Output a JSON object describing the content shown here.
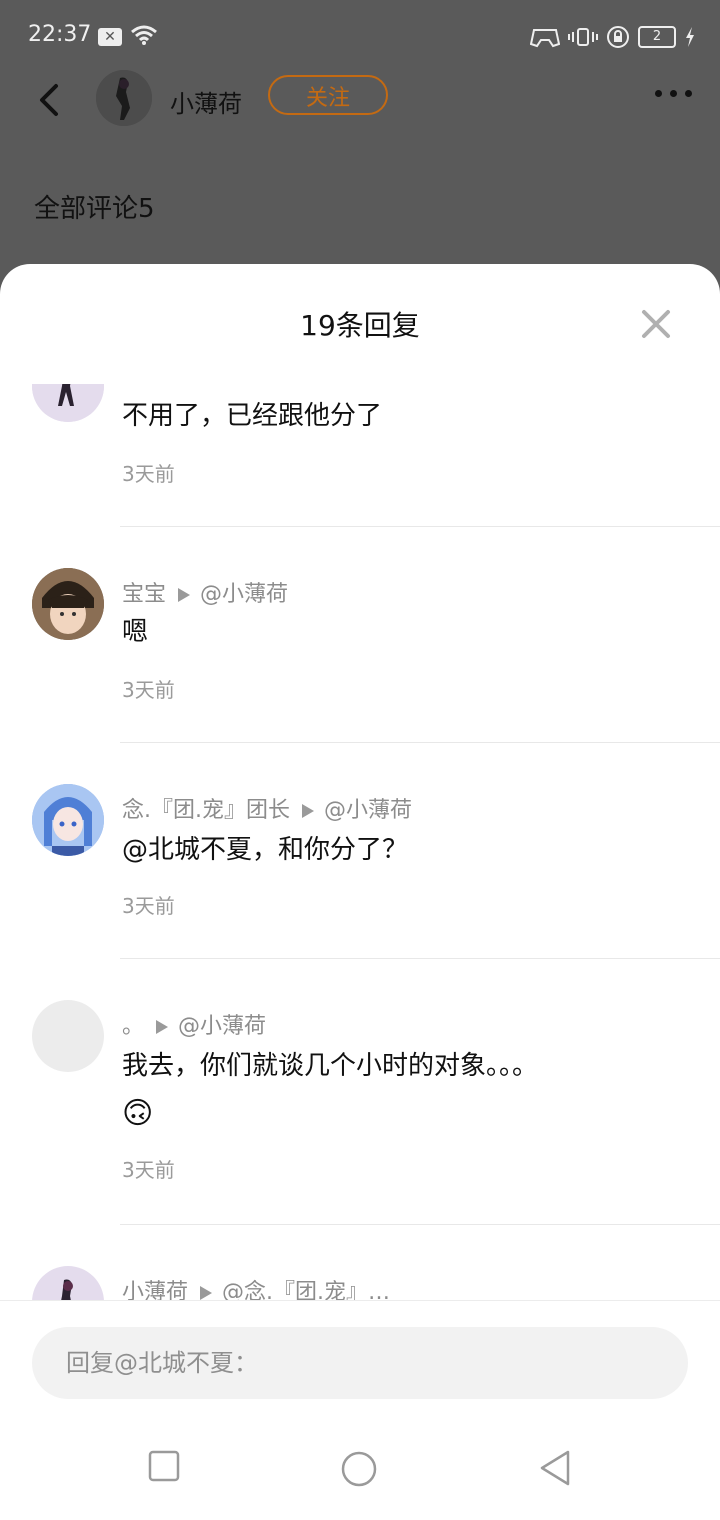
{
  "status": {
    "time": "22:37",
    "battery": "2"
  },
  "header": {
    "username": "小薄荷",
    "follow_label": "关注",
    "comments_heading": "全部评论5"
  },
  "sheet": {
    "title": "19条回复",
    "replies": [
      {
        "author": "",
        "target": "",
        "text": "不用了，已经跟他分了",
        "time": "3天前"
      },
      {
        "author": "宝宝",
        "target": "@小薄荷",
        "text": "嗯",
        "time": "3天前"
      },
      {
        "author": "念.『团.宠』团长",
        "target": "@小薄荷",
        "text": "@北城不夏，和你分了？",
        "time": "3天前"
      },
      {
        "author": "。",
        "target": "@小薄荷",
        "text": "我去，你们就谈几个小时的对象。。。",
        "emoji": "🙃",
        "time": "3天前"
      },
      {
        "author": "小薄荷",
        "target": "@念.『团.宠』…",
        "text": "",
        "time": ""
      }
    ]
  },
  "input": {
    "placeholder": "回复@北城不夏："
  },
  "colors": {
    "accent": "#c46a12",
    "overlay": "#5a5a5a"
  }
}
